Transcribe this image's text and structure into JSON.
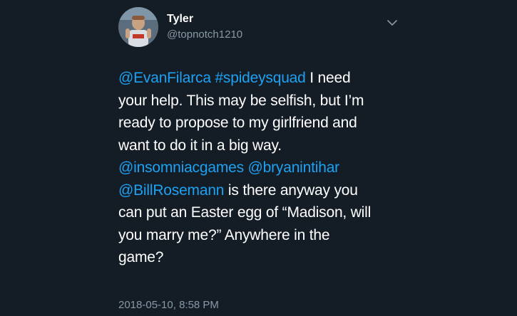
{
  "user": {
    "name": "Tyler",
    "handle": "@topnotch1210"
  },
  "tweet": {
    "mention_1": "@EvanFilarca",
    "hashtag_1": "#spideysquad",
    "line1_rest": " I need",
    "line2": "your help. This may be selfish, but I’m",
    "line3": "ready to propose to my girlfriend and",
    "line4": "want to do it in a big way.",
    "mention_2": "@insomniacgames",
    "mention_3": "@bryanintihar",
    "mention_4": "@BillRosemann",
    "line6_rest": " is there anyway you",
    "line7": "can put an Easter egg of “Madison, will",
    "line8": "you marry me?” Anywhere in the",
    "line9": "game?"
  },
  "timestamp": "2018-05-10, 8:58 PM",
  "icons": {
    "menu": "chevron-down-icon"
  },
  "colors": {
    "background": "#141d26",
    "link": "#1da1f2",
    "secondary_text": "#8899a6",
    "primary_text": "#ffffff"
  }
}
